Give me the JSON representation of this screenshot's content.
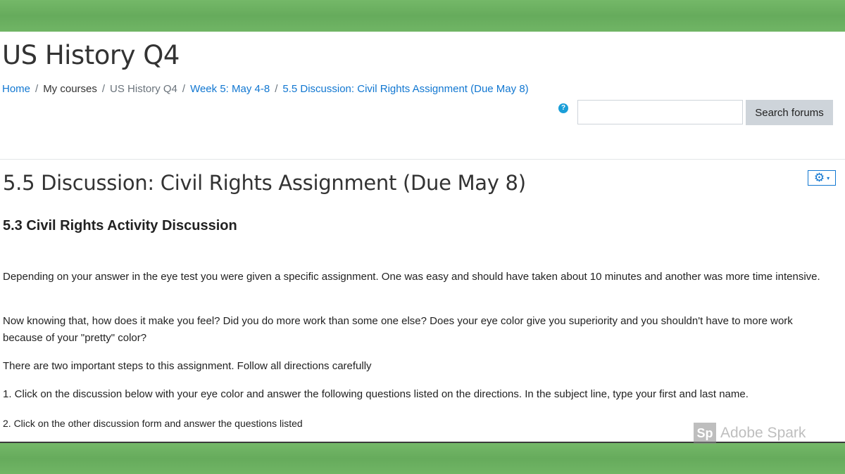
{
  "header": {
    "course_title": "US History Q4"
  },
  "breadcrumb": {
    "items": [
      "Home",
      "My courses",
      "US History Q4",
      "Week 5: May 4-8",
      "5.5 Discussion: Civil Rights Assignment (Due May 8)"
    ],
    "separator": "/"
  },
  "search": {
    "help_icon": "?",
    "value": "",
    "placeholder": "",
    "button_label": "Search forums"
  },
  "actions": {
    "gear_icon": "⚙",
    "caret_icon": "▾"
  },
  "main": {
    "title": "5.5 Discussion: Civil Rights Assignment (Due May 8)",
    "activity_heading": "5.3 Civil Rights Activity Discussion",
    "paragraphs": [
      "Depending on your answer in the eye test you were given a specific assignment. One was easy and should have taken about 10 minutes and another was more time intensive.",
      "Now knowing that, how does it make you feel? Did you do more work than some one else? Does your eye color give you superiority and you shouldn't have to more work because of your \"pretty\" color?",
      "There are two important steps to this assignment. Follow all directions carefully",
      "1. Click on the discussion below with your eye color and answer the following questions listed on the directions. In the subject line, type your first and last name.",
      "2. Click on the other discussion form and answer the questions listed"
    ]
  },
  "watermark": {
    "logo": "Sp",
    "brand": "Adobe Spark"
  },
  "colors": {
    "link": "#1177d1",
    "background_green": "#6cb062",
    "button_gray": "#ced4da"
  }
}
